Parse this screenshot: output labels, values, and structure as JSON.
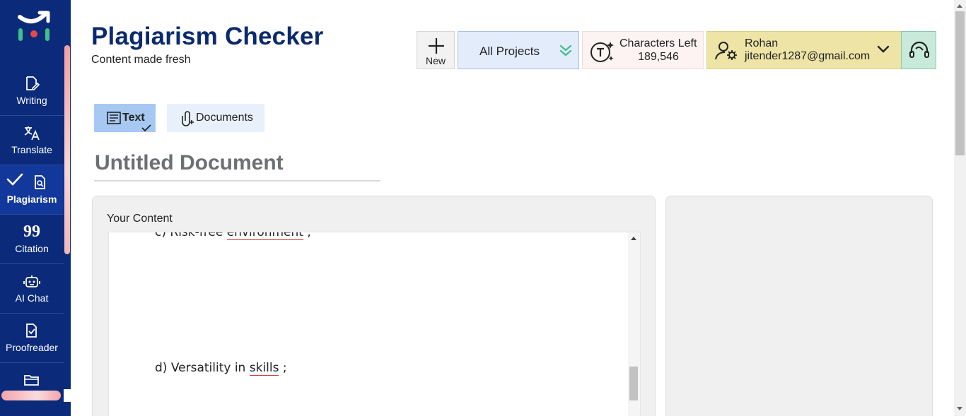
{
  "sidebar": {
    "logo_icon": "brand-logo-icon",
    "items": [
      {
        "label": "Writing",
        "icon": "writing-icon",
        "active": false
      },
      {
        "label": "Translate",
        "icon": "translate-icon",
        "active": false
      },
      {
        "label": "Plagiarism",
        "icon": "plagiarism-icon",
        "active": true
      },
      {
        "label": "Citation",
        "icon": "citation-icon",
        "active": false
      },
      {
        "label": "AI Chat",
        "icon": "robot-icon",
        "active": false
      },
      {
        "label": "Proofreader",
        "icon": "proofreader-icon",
        "active": false
      },
      {
        "label": "",
        "icon": "folder-icon",
        "active": false
      }
    ]
  },
  "header": {
    "title": "Plagiarism Checker",
    "subtitle": "Content made fresh",
    "new_label": "New",
    "projects_label": "All Projects",
    "characters_left_label": "Characters Left",
    "characters_left_value": "189,546",
    "user_name": "Rohan",
    "user_email": "jitender1287@gmail.com"
  },
  "tabs": [
    {
      "label": "Text",
      "icon": "text-doc-icon",
      "selected": true
    },
    {
      "label": "Documents",
      "icon": "attachment-icon",
      "selected": false
    }
  ],
  "document": {
    "title": "Untitled Document",
    "content_label": "Your Content",
    "lines": [
      {
        "prefix": "c) Risk-free ",
        "flagged": "environment",
        "suffix": " ;"
      },
      {
        "prefix": "d) Versatility in ",
        "flagged": "skills",
        "suffix": " ;"
      }
    ]
  },
  "colors": {
    "sidebar_bg": "#0b2a7a",
    "title_color": "#0b2a6e",
    "projects_bg": "#e3ecfb",
    "user_bg": "#ede4a6",
    "support_bg": "#c8eadb",
    "text_tab_bg": "#a7c8f2",
    "accent_green": "#3fbf8a"
  }
}
